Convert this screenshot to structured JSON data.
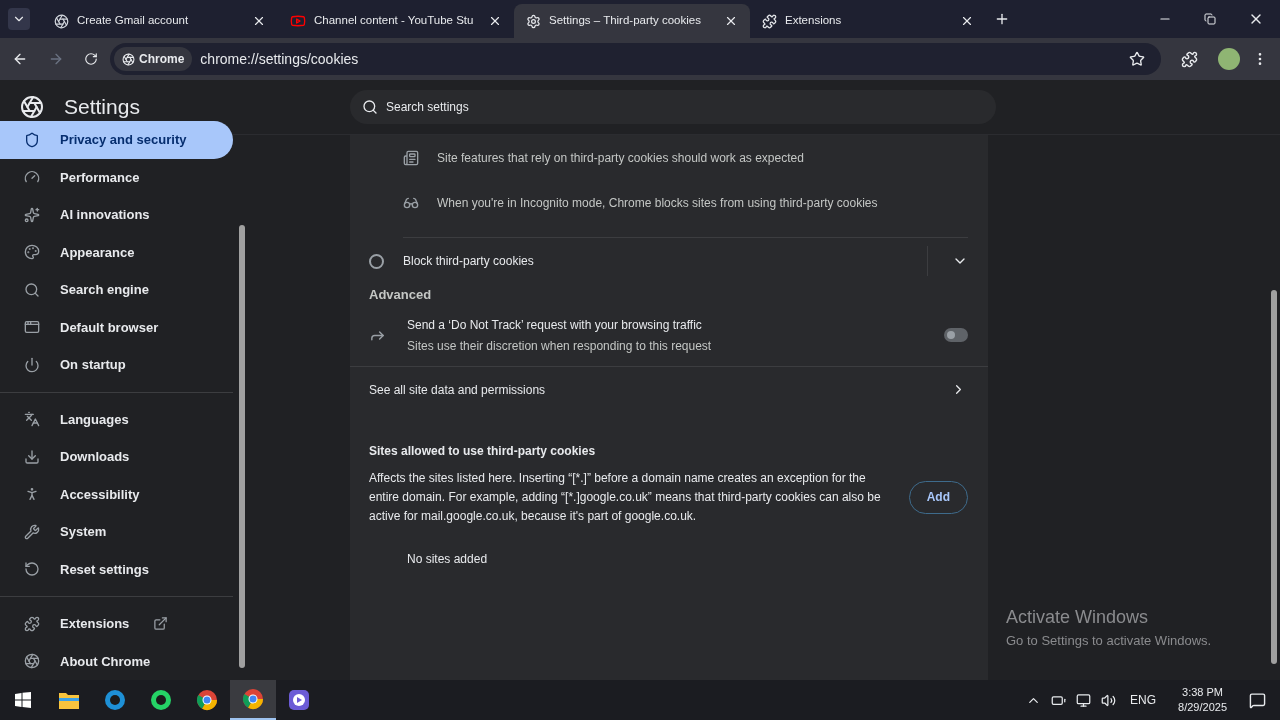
{
  "tabs": [
    {
      "title": "Create Gmail account",
      "selected": false
    },
    {
      "title": "Channel content - YouTube Stu",
      "selected": false
    },
    {
      "title": "Settings – Third-party cookies",
      "selected": true
    },
    {
      "title": "Extensions",
      "selected": false
    }
  ],
  "toolbar": {
    "chip": "Chrome",
    "url": "chrome://settings/cookies"
  },
  "header": {
    "title": "Settings",
    "search_placeholder": "Search settings"
  },
  "sidebar": {
    "groups": [
      [
        {
          "label": "Privacy and security",
          "selected": true
        },
        {
          "label": "Performance",
          "selected": false
        },
        {
          "label": "AI innovations",
          "selected": false
        },
        {
          "label": "Appearance",
          "selected": false
        },
        {
          "label": "Search engine",
          "selected": false
        },
        {
          "label": "Default browser",
          "selected": false
        },
        {
          "label": "On startup",
          "selected": false
        }
      ],
      [
        {
          "label": "Languages",
          "selected": false
        },
        {
          "label": "Downloads",
          "selected": false
        },
        {
          "label": "Accessibility",
          "selected": false
        },
        {
          "label": "System",
          "selected": false
        },
        {
          "label": "Reset settings",
          "selected": false
        }
      ],
      [
        {
          "label": "Extensions",
          "selected": false
        },
        {
          "label": "About Chrome",
          "selected": false
        }
      ]
    ]
  },
  "content": {
    "info_rows": [
      "Site features that rely on third-party cookies should work as expected",
      "When you're in Incognito mode, Chrome blocks sites from using third-party cookies"
    ],
    "block_option": {
      "label": "Block third-party cookies",
      "selected": false,
      "expanded": false
    },
    "advanced_heading": "Advanced",
    "do_not_track": {
      "title": "Send a ‘Do Not Track’ request with your browsing traffic",
      "subtitle": "Sites use their discretion when responding to this request",
      "on": false
    },
    "link_row": "See all site data and permissions",
    "allowed": {
      "title": "Sites allowed to use third-party cookies",
      "description": "Affects the sites listed here. Inserting “[*.]” before a domain name creates an exception for the entire domain. For example, adding “[*.]google.co.uk” means that third-party cookies can also be active for mail.google.co.uk, because it's part of google.co.uk.",
      "button": "Add",
      "empty": "No sites added"
    }
  },
  "activation": {
    "title": "Activate Windows",
    "subtitle": "Go to Settings to activate Windows."
  },
  "taskbar": {
    "apps": [
      {
        "selected": false
      },
      {
        "selected": false
      },
      {
        "selected": false
      },
      {
        "selected": false
      },
      {
        "selected": true
      },
      {
        "selected": false
      }
    ],
    "language": "ENG",
    "time": "3:38 PM",
    "date": "8/29/2025"
  }
}
